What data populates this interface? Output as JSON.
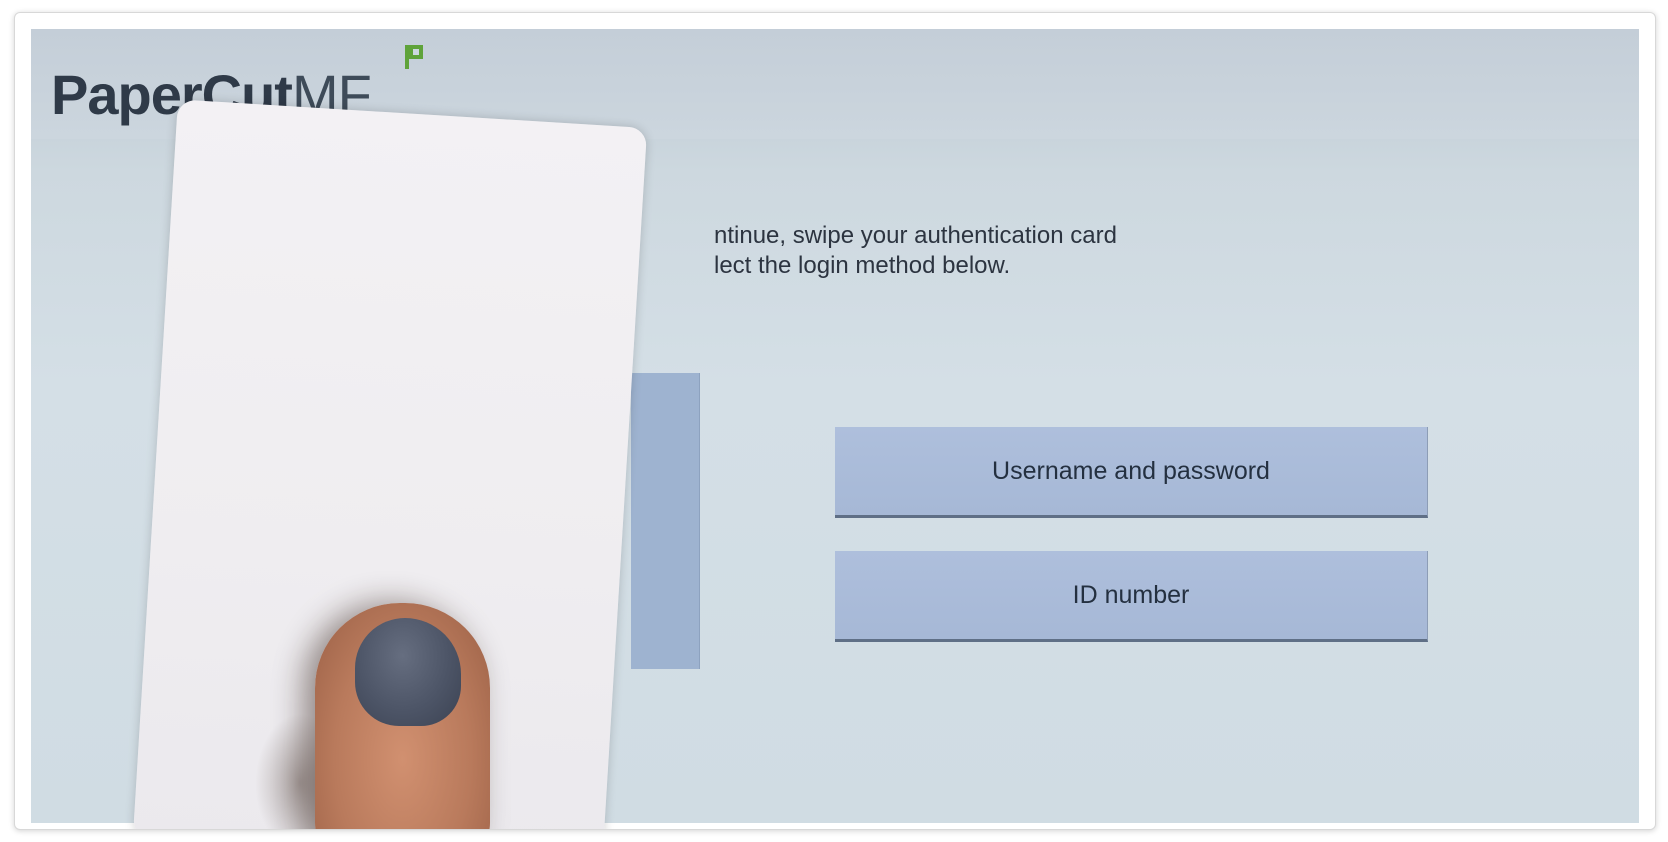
{
  "logo": {
    "word": "PaperCut",
    "suffix": "MF"
  },
  "instructions": {
    "line1": "ntinue, swipe your authentication card",
    "line2": "lect the login method below."
  },
  "login_methods": [
    {
      "label": "Username and password"
    },
    {
      "label": "ID number"
    }
  ],
  "colors": {
    "screen_bg": "#d0dce3",
    "button_bg": "#a9bad8",
    "text": "#243040"
  }
}
